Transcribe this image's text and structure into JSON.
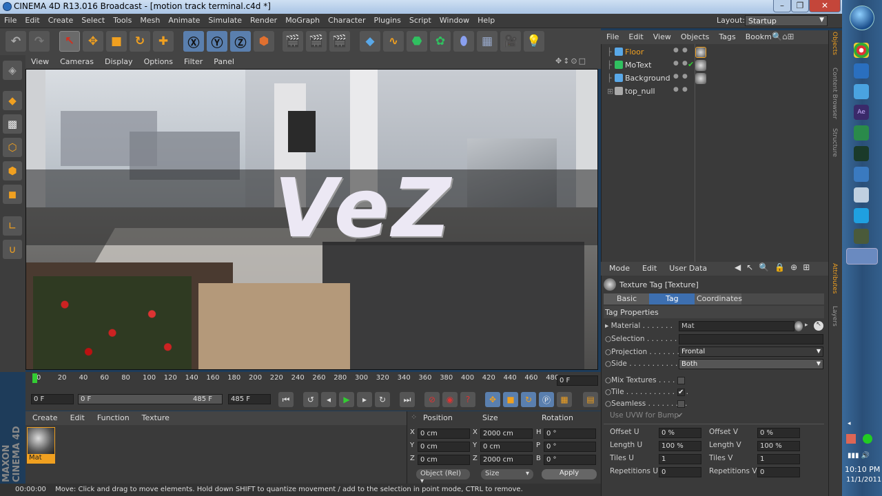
{
  "window": {
    "title": "CINEMA 4D R13.016 Broadcast - [motion track terminal.c4d *]"
  },
  "menubar": [
    "File",
    "Edit",
    "Create",
    "Select",
    "Tools",
    "Mesh",
    "Animate",
    "Simulate",
    "Render",
    "MoGraph",
    "Character",
    "Plugins",
    "Script",
    "Window",
    "Help"
  ],
  "layout": {
    "label": "Layout:",
    "value": "Startup"
  },
  "viewport": {
    "menu": [
      "View",
      "Cameras",
      "Display",
      "Options",
      "Filter",
      "Panel"
    ],
    "overlay_text": "VeZ"
  },
  "timeline": {
    "ticks": [
      "0",
      "20",
      "40",
      "60",
      "80",
      "100",
      "120",
      "140",
      "160",
      "180",
      "200",
      "220",
      "240",
      "260",
      "280",
      "300",
      "320",
      "340",
      "360",
      "380",
      "400",
      "420",
      "440",
      "460",
      "480"
    ],
    "current_frame": "0 F"
  },
  "transport": {
    "start": "0 F",
    "range_start": "0 F",
    "range_end": "485 F",
    "end": "485 F"
  },
  "material_panel": {
    "menu": [
      "Create",
      "Edit",
      "Function",
      "Texture"
    ],
    "material_name": "Mat"
  },
  "coords": {
    "headers": [
      "Position",
      "Size",
      "Rotation"
    ],
    "rows": [
      {
        "a": "X",
        "pos": "0 cm",
        "b": "X",
        "size": "2000 cm",
        "c": "H",
        "rot": "0 °"
      },
      {
        "a": "Y",
        "pos": "0 cm",
        "b": "Y",
        "size": "0 cm",
        "c": "P",
        "rot": "0 °"
      },
      {
        "a": "Z",
        "pos": "0 cm",
        "b": "Z",
        "size": "2000 cm",
        "c": "B",
        "rot": "0 °"
      }
    ],
    "mode": "Object (Rel)",
    "size_mode": "Size",
    "apply": "Apply"
  },
  "status": {
    "time": "00:00:00",
    "message": "Move: Click and drag to move elements. Hold down SHIFT to quantize movement / add to the selection in point mode, CTRL to remove."
  },
  "objects": {
    "menu": [
      "File",
      "Edit",
      "View",
      "Objects",
      "Tags",
      "Bookm"
    ],
    "items": [
      {
        "name": "Floor",
        "selected": true
      },
      {
        "name": "MoText",
        "selected": false
      },
      {
        "name": "Background",
        "selected": false
      },
      {
        "name": "top_null",
        "selected": false
      }
    ]
  },
  "attributes": {
    "menu": [
      "Mode",
      "Edit",
      "User Data"
    ],
    "title": "Texture Tag [Texture]",
    "tabs": [
      "Basic",
      "Tag",
      "Coordinates"
    ],
    "active_tab": "Tag",
    "section": "Tag Properties",
    "material_label": "Material",
    "material_value": "Mat",
    "selection_label": "Selection",
    "projection_label": "Projection",
    "projection_value": "Frontal",
    "side_label": "Side",
    "side_value": "Both",
    "mix_label": "Mix Textures",
    "tile_label": "Tile",
    "seamless_label": "Seamless",
    "uvw_label": "Use UVW for Bump",
    "offset_u_label": "Offset U",
    "offset_u": "0 %",
    "offset_v_label": "Offset V",
    "offset_v": "0 %",
    "length_u_label": "Length U",
    "length_u": "100 %",
    "length_v_label": "Length V",
    "length_v": "100 %",
    "tiles_u_label": "Tiles U",
    "tiles_u": "1",
    "tiles_v_label": "Tiles V",
    "tiles_v": "1",
    "reps_u_label": "Repetitions U",
    "reps_u": "0",
    "reps_v_label": "Repetitions V",
    "reps_v": "0"
  },
  "side_tabs": [
    "Objects",
    "Content Browser",
    "Structure",
    "Attributes",
    "Layers"
  ],
  "brand": {
    "text": "MAXON CINEMA 4D"
  },
  "taskbar": {
    "time": "10:10 PM",
    "date": "11/1/2011"
  },
  "colors": {
    "accent": "#f0a020",
    "selection_blue": "#3d6fb0",
    "background": "#3a3a3a"
  }
}
